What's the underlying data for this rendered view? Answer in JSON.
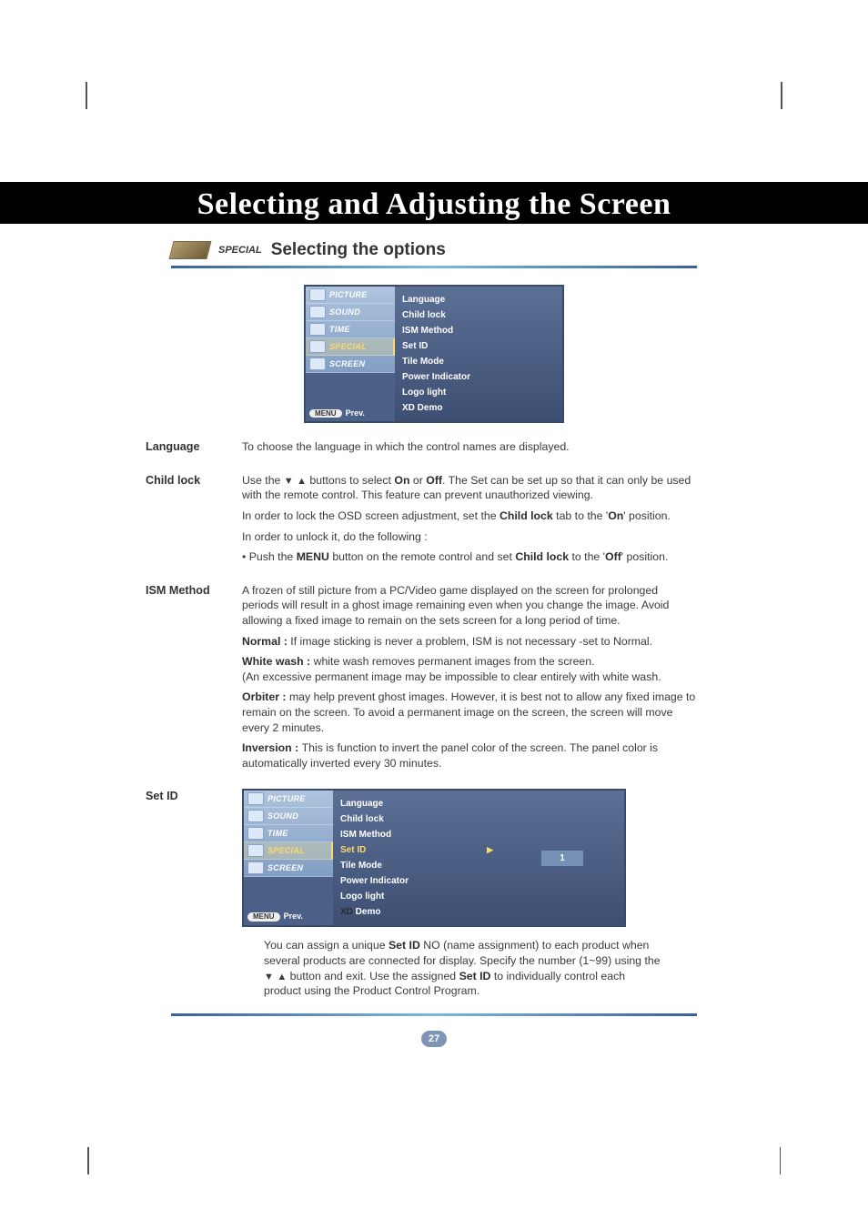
{
  "page": {
    "title": "Selecting and Adjusting the Screen",
    "section_tag_italic": "SPECIAL",
    "section_heading": "Selecting the options",
    "page_number": "27"
  },
  "osd": {
    "tabs": [
      "PICTURE",
      "SOUND",
      "TIME",
      "SPECIAL",
      "SCREEN"
    ],
    "menu_label": "MENU",
    "prev_label": "Prev.",
    "items": [
      "Language",
      "Child lock",
      "ISM Method",
      "Set ID",
      "Tile Mode",
      "Power Indicator",
      "Logo light"
    ],
    "xd_prefix": "XD",
    "xd_suffix": " Demo",
    "arrow": "▶",
    "value_label": "1"
  },
  "defs": {
    "language": {
      "label": "Language",
      "text": "To choose the language in which the control names are displayed."
    },
    "childlock": {
      "label": "Child lock",
      "p1_a": "Use the ",
      "p1_b": " buttons to select ",
      "on": "On",
      "or": " or ",
      "off": "Off",
      "p1_c": ". The Set can be set up so that it can only be used with the remote control. This feature can prevent unauthorized viewing.",
      "p2_a": "In order to lock the OSD screen adjustment, set the ",
      "p2_b": "Child lock",
      "p2_c": " tab to the '",
      "p2_d": "On",
      "p2_e": "' position.",
      "p3": "In order to unlock it, do the following :",
      "p4_a": "• Push the ",
      "p4_b": "MENU",
      "p4_c": " button on the remote control and set ",
      "p4_d": "Child lock",
      "p4_e": " to the '",
      "p4_f": "Off",
      "p4_g": "' position."
    },
    "ism": {
      "label": "ISM Method",
      "intro": "A frozen of still picture from a PC/Video game displayed on the screen for prolonged periods will result in a ghost image remaining even when you change the image. Avoid allowing a fixed image to remain on the sets screen for a long period of time.",
      "normal_h": "Normal : ",
      "normal_t": "If image sticking is never a problem, ISM is not necessary -set to Normal.",
      "white_h": "White wash :  ",
      "white_t1": "white wash removes permanent images from the screen.",
      "white_t2": "(An excessive permanent image may be impossible to clear entirely with white wash.",
      "orbiter_h": "Orbiter : ",
      "orbiter_t": "may help prevent ghost images. However, it is best not to allow any fixed image to remain on the screen. To avoid a permanent image on the screen, the screen will move every 2 minutes.",
      "inversion_h": "Inversion : ",
      "inversion_t": "This is function to invert the panel color of the screen. The panel color is automatically inverted every 30 minutes."
    },
    "setid": {
      "label": "Set ID",
      "para_a": "You can assign a unique ",
      "para_b": "Set ID",
      "para_c": " NO (name assignment) to each product when several products are connected for display. Specify the number (1~99) using the ",
      "para_d": " button and exit. Use the assigned ",
      "para_e": "Set ID",
      "para_f": " to individually control each product using the Product Control Program."
    }
  },
  "glyphs": {
    "down": "▼",
    "up": "▲"
  }
}
